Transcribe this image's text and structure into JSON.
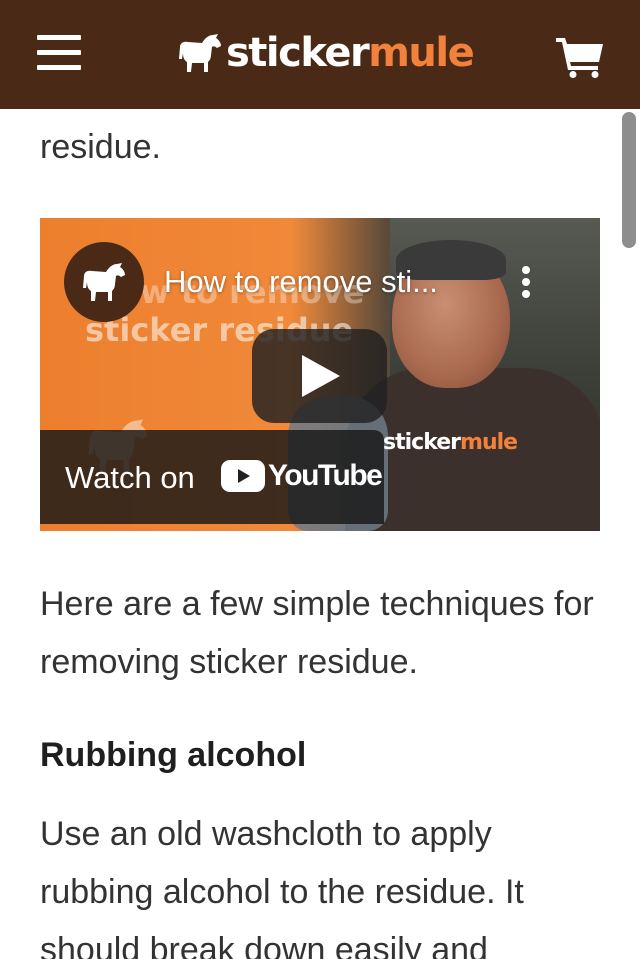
{
  "header": {
    "menu_icon": "hamburger-icon",
    "logo": {
      "part1": "sticker",
      "part2": "mule",
      "icon": "horse-icon"
    },
    "cart_icon": "cart-icon",
    "colors": {
      "background": "#4a2a17",
      "accent": "#f2813b"
    }
  },
  "article": {
    "fragment": "residue.",
    "video": {
      "title": "How to remove sti...",
      "overlay_text": "sticker residue",
      "overlay_text_top": "w to remove",
      "shirt_logo": {
        "part1": "sticker",
        "part2": "mule"
      },
      "watch_on": "Watch on",
      "youtube_label": "YouTube",
      "channel_icon": "stickermule-horse-icon",
      "play_icon": "play-icon",
      "more_icon": "more-vertical-icon"
    },
    "intro": "Here are a few simple techniques for removing sticker residue.",
    "section_heading": "Rubbing alcohol",
    "section_body": "Use an old washcloth to apply rubbing alcohol to the residue. It should break down easily and"
  }
}
